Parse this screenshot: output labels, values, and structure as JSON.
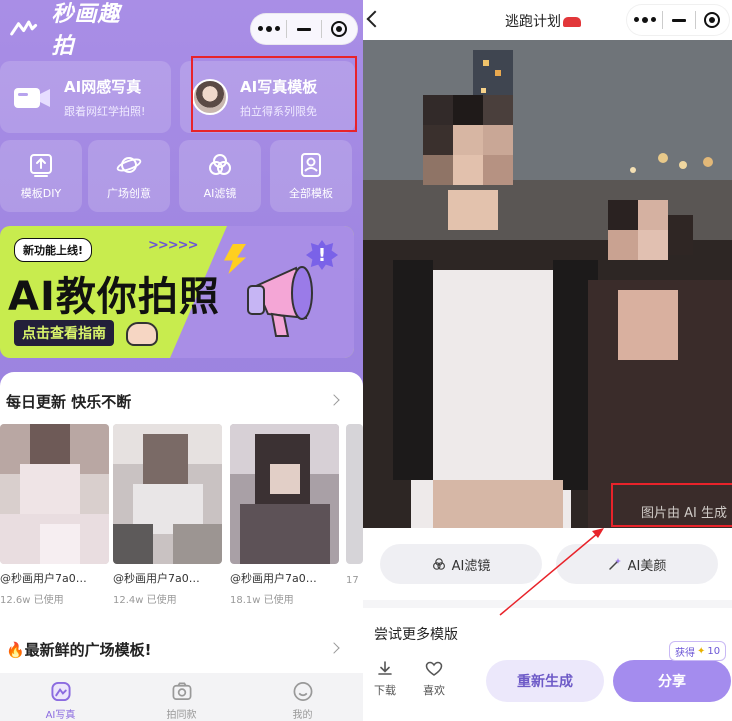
{
  "left": {
    "app_name": "秒画趣拍",
    "features": [
      {
        "title": "AI网感写真",
        "subtitle": "跟着网红学拍照!"
      },
      {
        "title": "AI写真模板",
        "subtitle": "拍立得系列限免"
      }
    ],
    "categories": [
      {
        "label": "模板DIY",
        "icon": "template-diy-icon"
      },
      {
        "label": "广场创意",
        "icon": "planet-icon"
      },
      {
        "label": "AI滤镜",
        "icon": "filter-circles-icon"
      },
      {
        "label": "全部模板",
        "icon": "portrait-frame-icon"
      }
    ],
    "banner": {
      "tag": "新功能上线!",
      "headline": "AI教你拍照",
      "cta": "点击查看指南",
      "arrows": ">>>>>",
      "exclaim": "!"
    },
    "section_daily": "每日更新 快乐不断",
    "cards": [
      {
        "name": "@秒画用户7a0…",
        "usage": "12.6w 已使用"
      },
      {
        "name": "@秒画用户7a0…",
        "usage": "12.4w 已使用"
      },
      {
        "name": "@秒画用户7a0…",
        "usage": "18.1w 已使用"
      },
      {
        "name": "",
        "usage": "17"
      }
    ],
    "section_square": "🔥最新鲜的广场模板!",
    "tabs": [
      {
        "label": "AI写真",
        "icon": "ai-portrait-icon",
        "active": true
      },
      {
        "label": "拍同款",
        "icon": "camera-icon",
        "active": false
      },
      {
        "label": "我的",
        "icon": "profile-icon",
        "active": false
      }
    ]
  },
  "right": {
    "title": "逃跑计划",
    "watermark": "图片由 AI 生成",
    "actions": [
      {
        "label": "AI滤镜",
        "icon": "filter-circles-icon"
      },
      {
        "label": "AI美颜",
        "icon": "magic-wand-icon"
      }
    ],
    "more_templates": "尝试更多模版",
    "bottom": {
      "download": "下载",
      "like": "喜欢",
      "regenerate": "重新生成",
      "share": "分享",
      "badge": "获得",
      "badge_count": "10"
    }
  },
  "colors": {
    "brand_purple": "#a48cee",
    "banner_lime": "#c8ec4e",
    "highlight_red": "#e8232a"
  }
}
